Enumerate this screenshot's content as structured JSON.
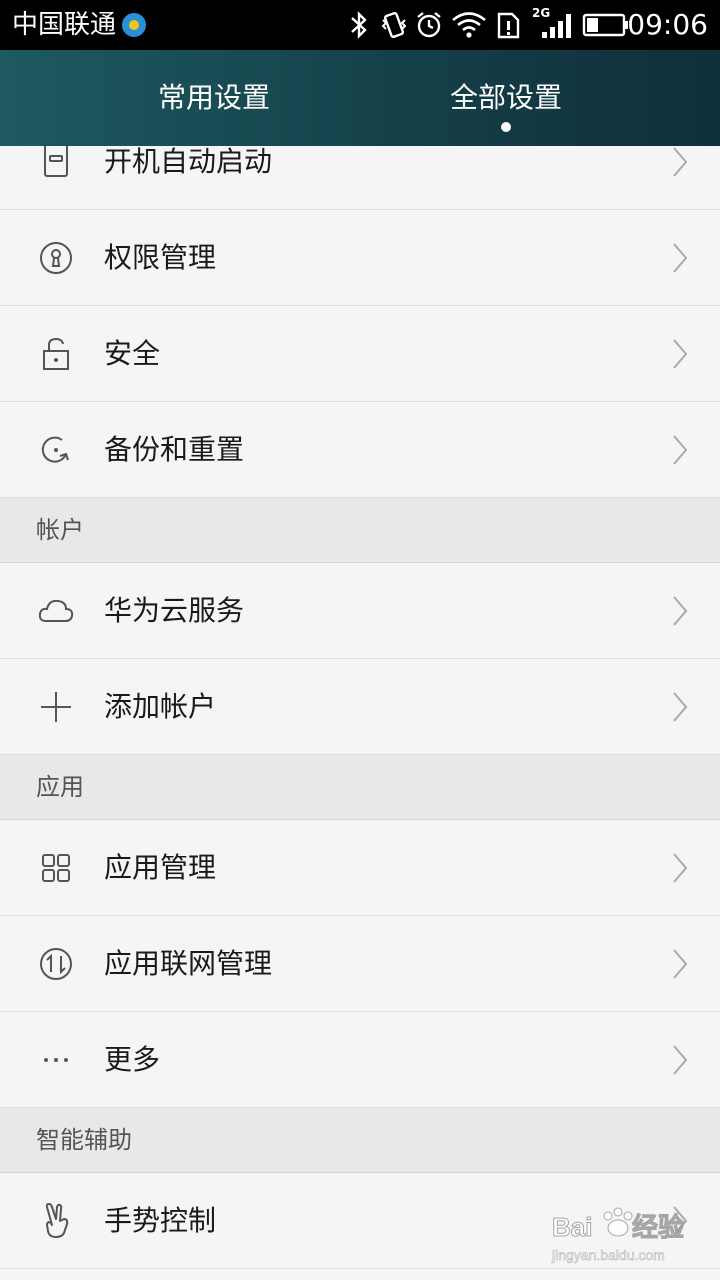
{
  "status_bar": {
    "carrier": "中国联通",
    "network_type": "2G",
    "time": "09:06",
    "icons": [
      "bluetooth-icon",
      "vibrate-icon",
      "alarm-icon",
      "wifi-icon",
      "sim-alert-icon",
      "signal-icon",
      "battery-icon"
    ]
  },
  "tabs": [
    {
      "label": "常用设置",
      "active": false
    },
    {
      "label": "全部设置",
      "active": true
    }
  ],
  "top_items": [
    {
      "label": "开机自动启动",
      "icon": "startup-icon"
    },
    {
      "label": "权限管理",
      "icon": "keyhole-icon"
    },
    {
      "label": "安全",
      "icon": "lock-icon"
    },
    {
      "label": "备份和重置",
      "icon": "backup-icon"
    }
  ],
  "sections": [
    {
      "title": "帐户",
      "items": [
        {
          "label": "华为云服务",
          "icon": "cloud-icon"
        },
        {
          "label": "添加帐户",
          "icon": "plus-icon"
        }
      ]
    },
    {
      "title": "应用",
      "items": [
        {
          "label": "应用管理",
          "icon": "grid-icon"
        },
        {
          "label": "应用联网管理",
          "icon": "network-arrows-icon"
        },
        {
          "label": "更多",
          "icon": "more-dots-icon"
        }
      ]
    },
    {
      "title": "智能辅助",
      "items": [
        {
          "label": "手势控制",
          "icon": "gesture-hand-icon"
        }
      ]
    }
  ],
  "watermark": {
    "brand": "Baidu 经验",
    "url": "jingyan.baidu.com"
  },
  "colors": {
    "tab_bar": "#1a4a52",
    "background": "#f5f5f5",
    "section_header": "#e8e8e8"
  }
}
